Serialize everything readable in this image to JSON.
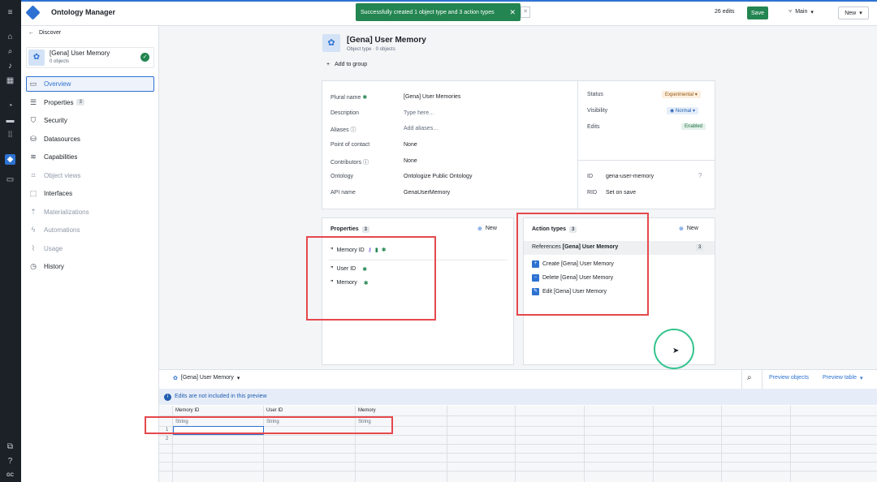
{
  "app": {
    "title": "Ontology Manager",
    "user_initials": "GC"
  },
  "toast": {
    "message": "Successfully created 1 object type and 3 action types"
  },
  "header": {
    "edits": "26 edits",
    "save": "Save",
    "branch": "Main",
    "new": "New"
  },
  "side": {
    "back": "Discover",
    "object_name": "[Gena] User Memory",
    "object_count": "0 objects",
    "nav": [
      {
        "label": "Overview",
        "icon": "overview-icon"
      },
      {
        "label": "Properties",
        "badge": "3",
        "icon": "list-icon"
      },
      {
        "label": "Security",
        "icon": "shield-icon"
      },
      {
        "label": "Datasources",
        "icon": "database-icon"
      },
      {
        "label": "Capabilities",
        "icon": "layers-icon"
      },
      {
        "label": "Object views",
        "icon": "object-view-icon"
      },
      {
        "label": "Interfaces",
        "icon": "interface-icon"
      },
      {
        "label": "Materializations",
        "icon": "upload-icon"
      },
      {
        "label": "Automations",
        "icon": "lightning-icon"
      },
      {
        "label": "Usage",
        "icon": "chart-icon"
      },
      {
        "label": "History",
        "icon": "history-icon"
      }
    ]
  },
  "main": {
    "title": "[Gena] User Memory",
    "subtitle": "Object type · 0 objects",
    "add_group": "Add to group",
    "fields": [
      {
        "label": "Plural name",
        "value": "[Gena] User Memories"
      },
      {
        "label": "Description",
        "value": "Type here…"
      },
      {
        "label": "Aliases",
        "value": "Add aliases…"
      },
      {
        "label": "Point of contact",
        "value": "None"
      },
      {
        "label": "Contributors",
        "value": "None"
      },
      {
        "label": "Ontology",
        "value": "Ontologize Public Ontology"
      },
      {
        "label": "API name",
        "value": "GenaUserMemory"
      }
    ],
    "status": {
      "label": "Status",
      "value": "Experimental"
    },
    "visibility": {
      "label": "Visibility",
      "value": "Normal"
    },
    "edits": {
      "label": "Edits",
      "value": "Enabled"
    },
    "id": {
      "label": "ID",
      "value": "gena-user-memory"
    },
    "rid": {
      "label": "RID",
      "value": "Set on save"
    }
  },
  "properties": {
    "title": "Properties",
    "count": "3",
    "new": "New",
    "items": [
      "Memory ID",
      "User ID",
      "Memory"
    ]
  },
  "actions": {
    "title": "Action types",
    "count": "3",
    "new": "New",
    "ref_prefix": "References",
    "ref_name": "[Gena] User Memory",
    "ref_count": "3",
    "items": [
      "Create [Gena] User Memory",
      "Delete [Gena] User Memory",
      "Edit [Gena] User Memory"
    ]
  },
  "preview": {
    "selector": "[Gena] User Memory",
    "preview_objects": "Preview objects",
    "preview_table": "Preview table",
    "notice": "Edits are not included in this preview",
    "columns": [
      "Memory ID",
      "User ID",
      "Memory"
    ],
    "types": [
      "String",
      "String",
      "String"
    ],
    "rows": [
      "1",
      "2"
    ]
  },
  "colors": {
    "accent": "#2d72d2",
    "save": "#238551",
    "toast": "#238551",
    "highlight": "#e5484d"
  }
}
